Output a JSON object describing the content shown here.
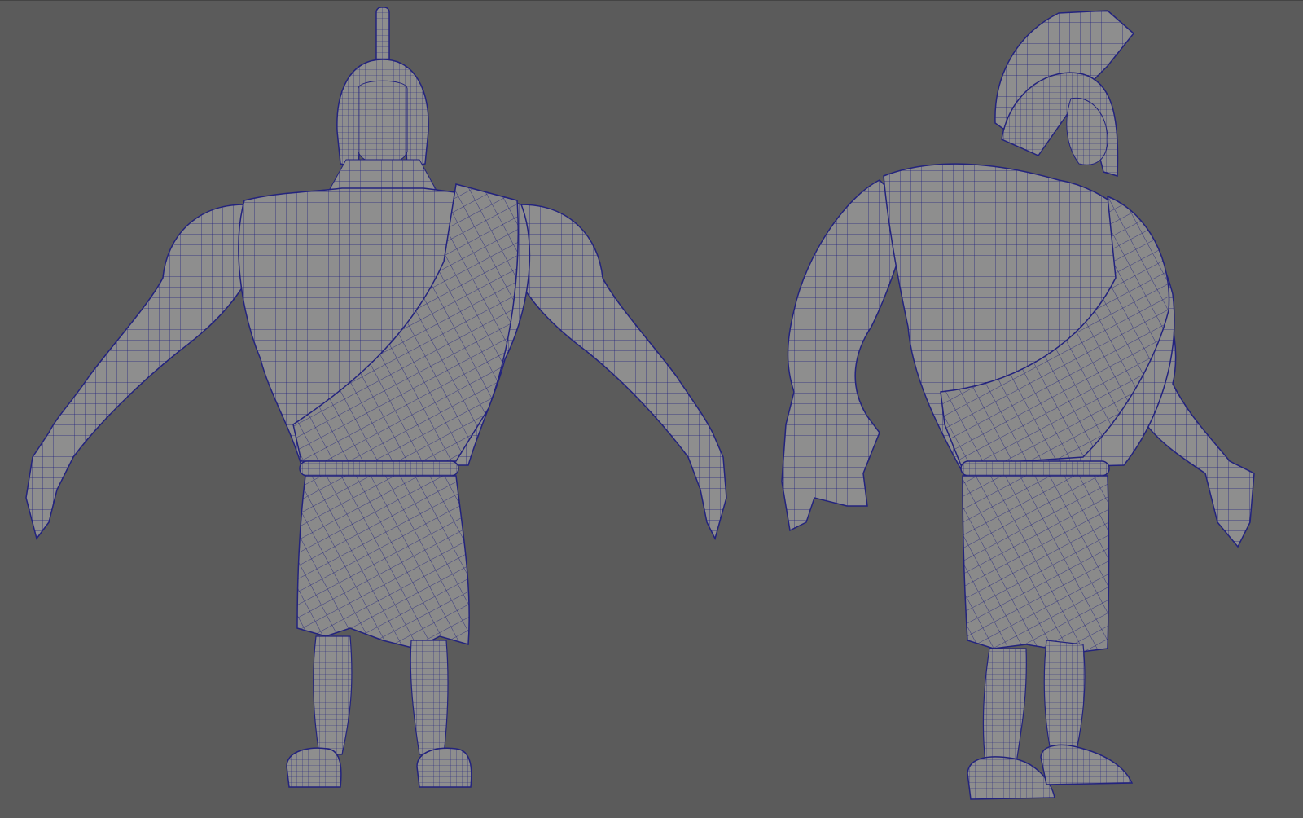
{
  "viewport": {
    "background": "#5b5b5b",
    "mesh_fill": "#8c8c8c",
    "mesh_shadow": "#6f6f6f",
    "wire_color": "#1c1c7a"
  },
  "models": [
    {
      "name": "character-front-view",
      "view": "front"
    },
    {
      "name": "character-three-quarter-view",
      "view": "three-quarter"
    }
  ]
}
